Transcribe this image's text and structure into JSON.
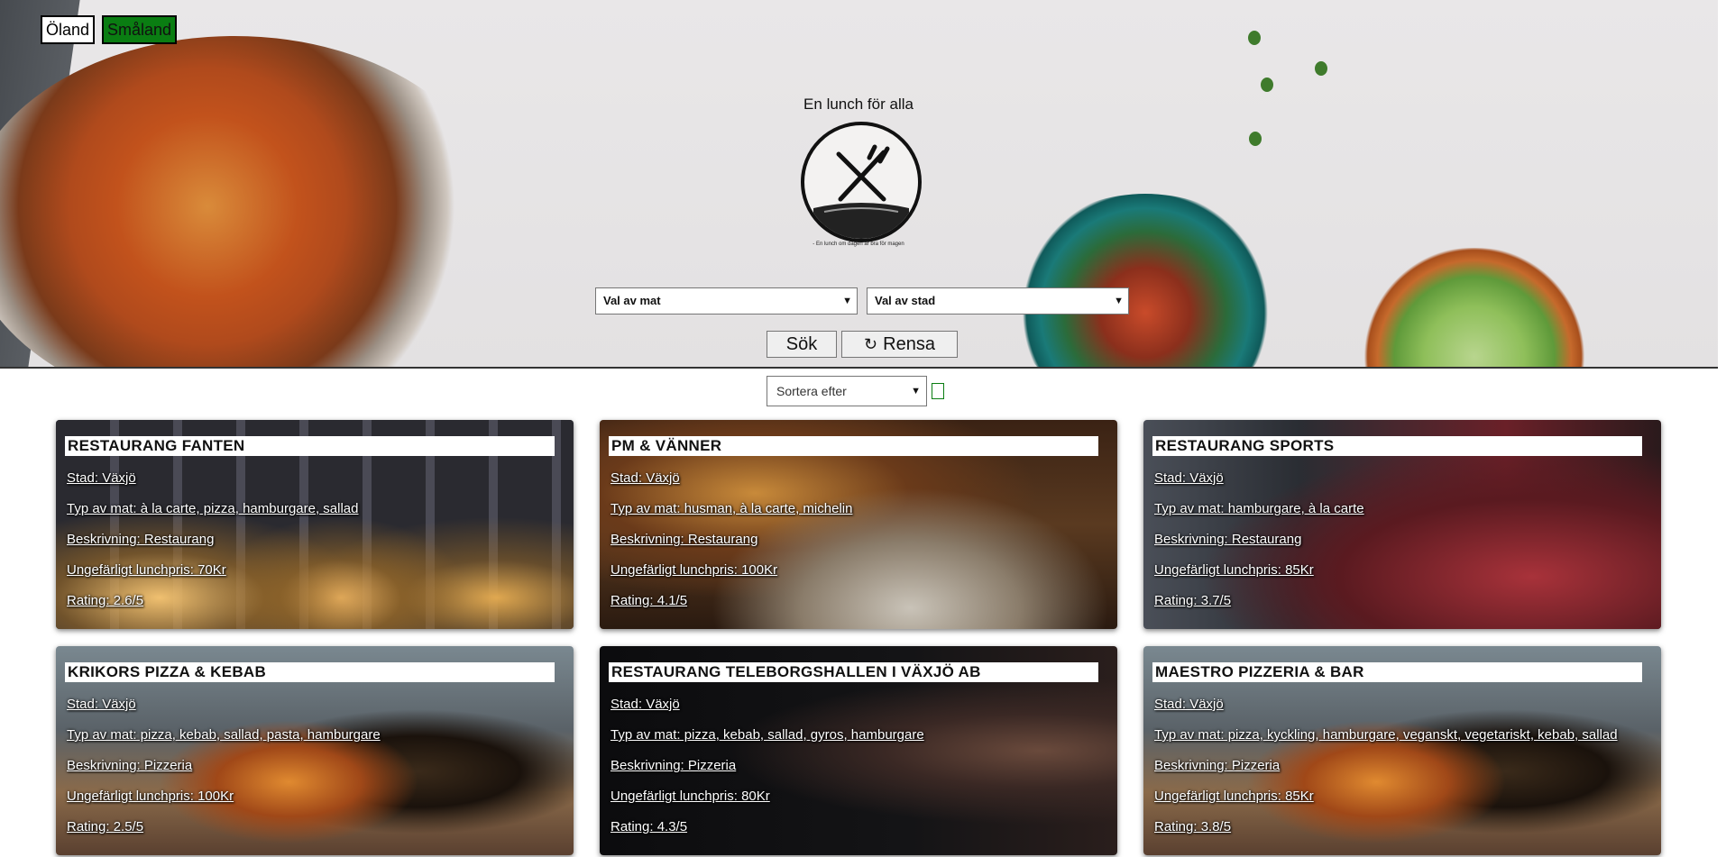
{
  "regions": {
    "oland": "Öland",
    "smaland": "Småland"
  },
  "logo": {
    "title": "En lunch för alla",
    "subtitle": "- En lunch om dagen är bra för magen"
  },
  "filters": {
    "food": "Val av mat",
    "city": "Val av stad"
  },
  "actions": {
    "search": "Sök",
    "clear": "Rensa"
  },
  "sort": {
    "label": "Sortera efter"
  },
  "colors": {
    "smaland_bg": "#0a7d12",
    "card_text": "#ffffff"
  },
  "restaurants": [
    {
      "name": "RESTAURANG FANTEN",
      "city": "Stad: Växjö",
      "food": "Typ av mat: à la carte, pizza, hamburgare, sallad",
      "desc": "Beskrivning: Restaurang",
      "price": "Ungefärligt lunchpris: 70Kr",
      "rating": "Rating: 2.6/5"
    },
    {
      "name": "PM & VÄNNER",
      "city": "Stad: Växjö",
      "food": "Typ av mat: husman, à la carte, michelin",
      "desc": "Beskrivning: Restaurang",
      "price": "Ungefärligt lunchpris: 100Kr",
      "rating": "Rating: 4.1/5"
    },
    {
      "name": "RESTAURANG SPORTS",
      "city": "Stad: Växjö",
      "food": "Typ av mat: hamburgare, à la carte",
      "desc": "Beskrivning: Restaurang",
      "price": "Ungefärligt lunchpris: 85Kr",
      "rating": "Rating: 3.7/5"
    },
    {
      "name": "KRIKORS PIZZA & KEBAB",
      "city": "Stad: Växjö",
      "food": "Typ av mat: pizza, kebab, sallad, pasta, hamburgare",
      "desc": "Beskrivning: Pizzeria",
      "price": "Ungefärligt lunchpris: 100Kr",
      "rating": "Rating: 2.5/5"
    },
    {
      "name": "RESTAURANG TELEBORGSHALLEN I VÄXJÖ AB",
      "city": "Stad: Växjö",
      "food": "Typ av mat: pizza, kebab, sallad, gyros, hamburgare",
      "desc": "Beskrivning: Pizzeria",
      "price": "Ungefärligt lunchpris: 80Kr",
      "rating": "Rating: 4.3/5"
    },
    {
      "name": "MAESTRO PIZZERIA & BAR",
      "city": "Stad: Växjö",
      "food": "Typ av mat: pizza, kyckling, hamburgare, veganskt, vegetariskt, kebab, sallad",
      "desc": "Beskrivning: Pizzeria",
      "price": "Ungefärligt lunchpris: 85Kr",
      "rating": "Rating: 3.8/5"
    }
  ]
}
